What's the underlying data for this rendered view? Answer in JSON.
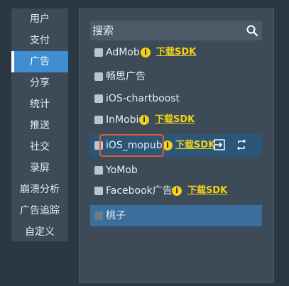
{
  "sidebar": {
    "items": [
      {
        "label": "用户"
      },
      {
        "label": "支付"
      },
      {
        "label": "广告",
        "active": true
      },
      {
        "label": "分享"
      },
      {
        "label": "统计"
      },
      {
        "label": "推送"
      },
      {
        "label": "社交"
      },
      {
        "label": "录屏"
      },
      {
        "label": "崩溃分析"
      },
      {
        "label": "广告追踪"
      },
      {
        "label": "自定义"
      }
    ]
  },
  "search": {
    "placeholder": "搜索",
    "value": "",
    "icon": "search-icon"
  },
  "plugins": [
    {
      "name": "AdMob",
      "info": "i",
      "sdk_link": "下载SDK"
    },
    {
      "name": "畅思广告"
    },
    {
      "name": "iOS-chartboost"
    },
    {
      "name": "InMobi",
      "info": "i",
      "sdk_link": "下载SDK"
    },
    {
      "name": "iOS_mopub",
      "info": "i",
      "sdk_link": "下载SDK",
      "actions": [
        "import-icon",
        "switch-icon"
      ],
      "highlighted": true
    },
    {
      "name": "YoMob"
    },
    {
      "name": "Facebook广告",
      "info": "i",
      "sdk_link": "下载SDK"
    },
    {
      "name": "桃子",
      "selected": true
    }
  ],
  "colors": {
    "background": "#2b3742",
    "panel": "#3d4b58",
    "accent": "#3f8ed2",
    "link": "#f2d218",
    "highlight_row": "#2b5678",
    "selected_row": "#3a6f9c",
    "focus_outline": "#e05a35"
  }
}
